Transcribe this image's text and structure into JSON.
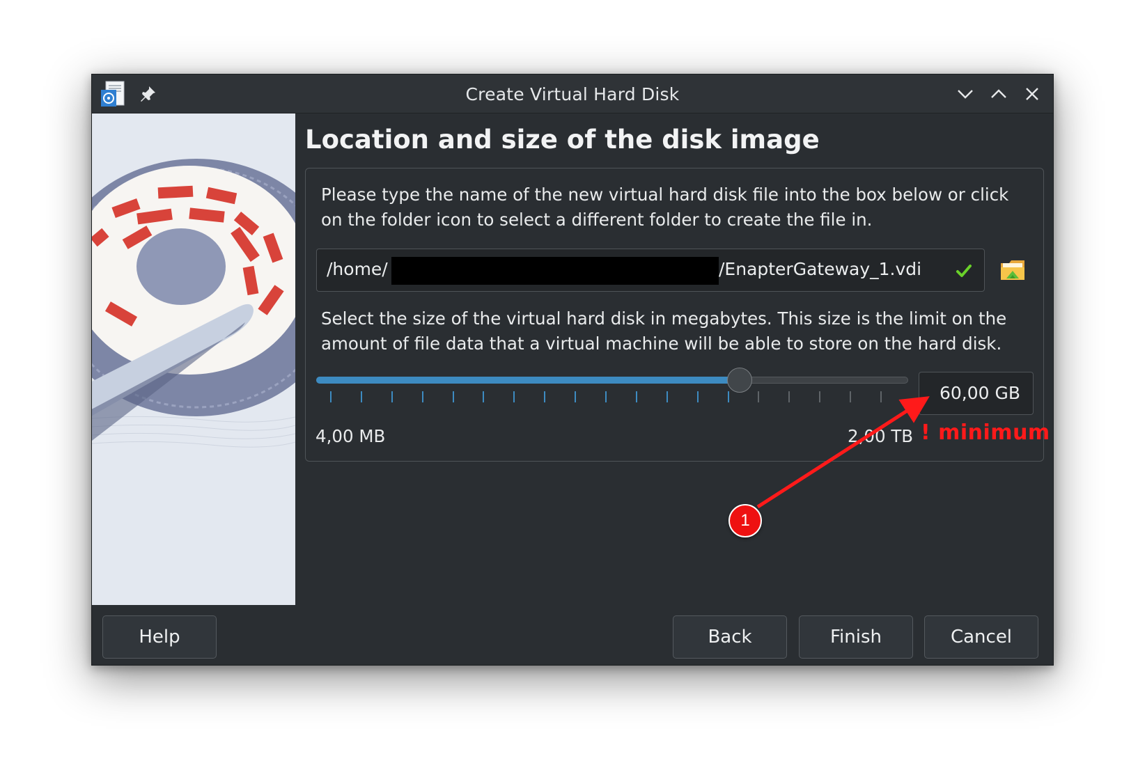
{
  "window": {
    "title": "Create Virtual Hard Disk",
    "icons": {
      "app": "virtualbox-disk-icon",
      "pin": "pin-icon",
      "minimize": "chevron-down-icon",
      "maximize": "chevron-up-icon",
      "close": "close-icon"
    }
  },
  "page": {
    "heading": "Location and size of the disk image",
    "location_description": "Please type the name of the new virtual hard disk file into the box below or click on the folder icon to select a different folder to create the file in.",
    "path_prefix": "/home/",
    "path_suffix": "/EnapterGateway_1.vdi",
    "size_description": "Select the size of the virtual hard disk in megabytes. This size is the limit on the amount of file data that a virtual machine will be able to store on the hard disk.",
    "size_value": "60,00 GB",
    "slider_min_label": "4,00 MB",
    "slider_max_label": "2,00 TB",
    "slider_position": 0.72,
    "tick_count": 19
  },
  "buttons": {
    "help": "Help",
    "back": "Back",
    "finish": "Finish",
    "cancel": "Cancel"
  },
  "annotation": {
    "note": "! minimum",
    "badge": "1"
  },
  "colors": {
    "accent": "#3d8bc1",
    "valid": "#6ad12a",
    "annotation": "#ff1a1a"
  }
}
